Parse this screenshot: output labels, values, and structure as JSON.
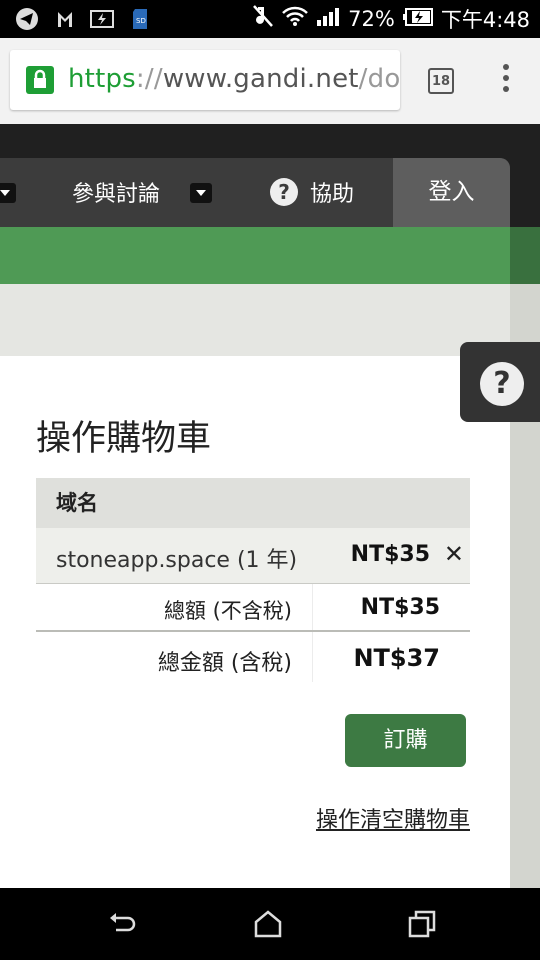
{
  "status_bar": {
    "battery": "72%",
    "time": "下午4:48",
    "icons": [
      "telegram-icon",
      "gmail-icon",
      "battery-charging-icon",
      "sd-card-icon",
      "mute-icon",
      "wifi-icon",
      "signal-icon",
      "battery-icon"
    ]
  },
  "browser": {
    "url_scheme": "https",
    "url_sep": "://",
    "url_host": "www.gandi.net",
    "url_path": "/don",
    "tab_count": "18"
  },
  "nav": {
    "discuss": "參與討論",
    "help": "協助",
    "login": "登入"
  },
  "cart": {
    "title": "操作購物車",
    "column_header": "域名",
    "items": [
      {
        "name": "stoneapp.space (1 年)",
        "price": "NT$35",
        "remove": "✕"
      }
    ],
    "subtotal_label": "總額 (不含稅)",
    "subtotal_value": "NT$35",
    "total_label": "總金額 (含稅)",
    "total_value": "NT$37",
    "order_button": "訂購",
    "empty_link": "操作清空購物車"
  },
  "help_float": "?",
  "colors": {
    "green": "#4f9a55",
    "button_green": "#3d7a43",
    "lock_green": "#1e9e35"
  }
}
